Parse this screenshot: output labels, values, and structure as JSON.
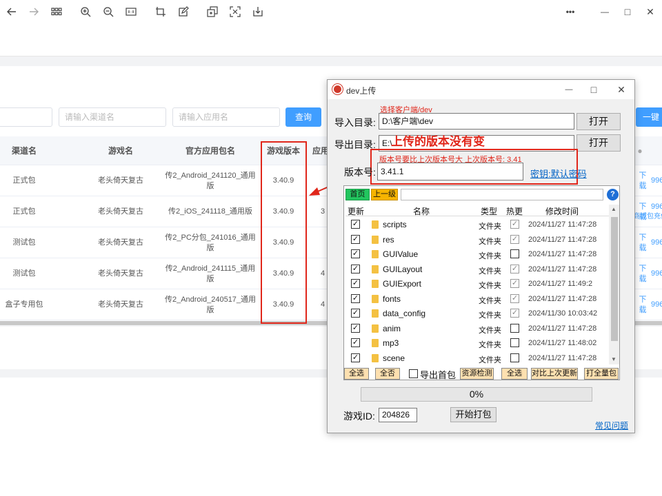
{
  "browser": {
    "more_label": "•••",
    "minimize_label": "—",
    "maximize_label": "□",
    "close_label": "✕"
  },
  "filters": {
    "channel_placeholder": "请输入渠道名",
    "app_placeholder": "请输入应用名",
    "query_label": "查询",
    "one_click_label": "一键"
  },
  "table": {
    "headers": [
      "渠道名",
      "游戏名",
      "官方应用包名",
      "游戏版本",
      "应用"
    ],
    "rows": [
      {
        "channel": "正式包",
        "game": "老头倚天复古",
        "package": "传2_Android_241120_通用版",
        "version": "3.40.9",
        "extra": "",
        "action": "下载",
        "count": "996"
      },
      {
        "channel": "正式包",
        "game": "老头倚天复古",
        "package": "传2_iOS_241118_通用版",
        "version": "3.40.9",
        "extra": "3",
        "action": "下载",
        "count": "996"
      },
      {
        "channel": "测试包",
        "game": "老头倚天复古",
        "package": "传2_PC分包_241016_通用版",
        "version": "3.40.9",
        "extra": "",
        "action": "下载",
        "count": "996"
      },
      {
        "channel": "测试包",
        "game": "老头倚天复古",
        "package": "传2_Android_241115_通用版",
        "version": "3.40.9",
        "extra": "4",
        "action": "下载",
        "count": "996"
      },
      {
        "channel": "盒子专用包",
        "game": "老头倚天复古",
        "package": "传2_Android_240517_通用版",
        "version": "3.40.9",
        "extra": "4",
        "action": "下载",
        "count": "996"
      }
    ],
    "side_note": "商城包充值"
  },
  "dialog": {
    "title": "dev上传",
    "choose_hint": "选择客户端/dev",
    "import_label": "导入目录:",
    "import_value": "D:\\客户端\\dev",
    "open_label": "打开",
    "export_label": "导出目录:",
    "export_value": "E:\\",
    "annotation": "上传的版本没有变",
    "version_hint": "版本号要比上次版本号大  上次版本号: 3.41",
    "version_label": "版本号:",
    "version_value": "3.41.1",
    "key_link": "密钥:默认密码",
    "home_label": "首页",
    "up_label": "上一级",
    "help_icon": "?",
    "columns": [
      "更新",
      "名称",
      "类型",
      "热更",
      "修改时间"
    ],
    "files": [
      {
        "name": "scripts",
        "type": "文件夹",
        "hot": true,
        "time": "2024/11/27 11:47:28"
      },
      {
        "name": "res",
        "type": "文件夹",
        "hot": true,
        "time": "2024/11/27 11:47:28"
      },
      {
        "name": "GUIValue",
        "type": "文件夹",
        "hot": false,
        "time": "2024/11/27 11:47:28"
      },
      {
        "name": "GUILayout",
        "type": "文件夹",
        "hot": true,
        "time": "2024/11/27 11:47:28"
      },
      {
        "name": "GUIExport",
        "type": "文件夹",
        "hot": true,
        "time": "2024/11/27 11:49:2"
      },
      {
        "name": "fonts",
        "type": "文件夹",
        "hot": true,
        "time": "2024/11/27 11:47:28"
      },
      {
        "name": "data_config",
        "type": "文件夹",
        "hot": true,
        "time": "2024/11/30 10:03:42"
      },
      {
        "name": "anim",
        "type": "文件夹",
        "hot": false,
        "time": "2024/11/27 11:47:28"
      },
      {
        "name": "mp3",
        "type": "文件夹",
        "hot": false,
        "time": "2024/11/27 11:48:02"
      },
      {
        "name": "scene",
        "type": "文件夹",
        "hot": false,
        "time": "2024/11/27 11:47:28"
      }
    ],
    "select_all": "全选",
    "select_none": "全否",
    "export_home_label": "导出首包",
    "resource_check": "资源检测",
    "select_all_2": "全选",
    "compare_label": "对比上次更新",
    "pack_all": "打全量包",
    "progress": "0%",
    "game_id_label": "游戏ID:",
    "game_id_value": "204826",
    "start_pack": "开始打包",
    "faq": "常见问题",
    "minimize": "—",
    "maximize": "□",
    "close": "✕"
  }
}
